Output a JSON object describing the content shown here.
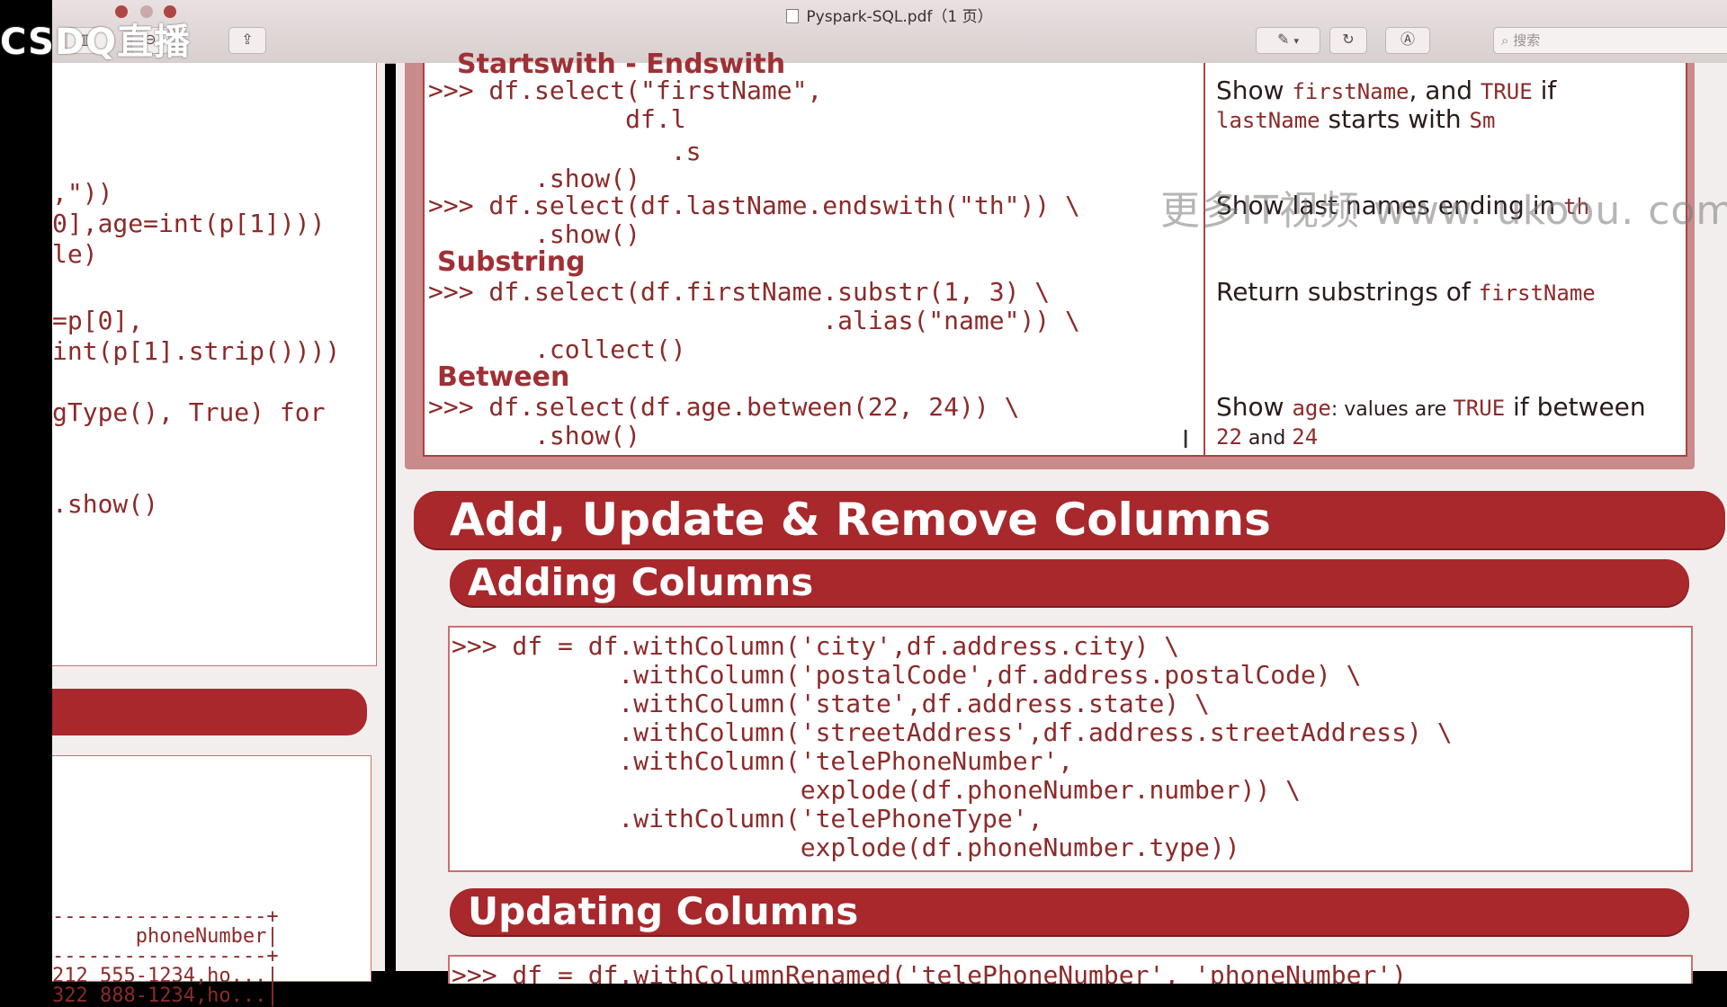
{
  "window": {
    "title": "Pyspark-SQL.pdf（1 页）",
    "overlay_logo": "CSDQ直播",
    "search_placeholder": "搜索",
    "toolbar": {
      "sidebar_icon": "sidebar-icon",
      "zoom_icon": "zoom-icon",
      "share_icon": "share-icon",
      "markup_icon": "pen-icon",
      "rotate_icon": "rotate-icon",
      "annotate_icon": "annotate-icon",
      "search_icon": "search-icon"
    }
  },
  "left_pane": {
    "code_lines": [
      ",\"))",
      "0],age=int(p[1])))",
      "le)",
      "=p[0],",
      "int(p[1].strip())))",
      "gType(), True) for",
      ".show()"
    ],
    "table_lines": [
      "------------------+",
      "       phoneNumber|",
      "------------------+",
      "212 555-1234,ho...|",
      "322 888-1234,ho...|",
      "------------------+"
    ]
  },
  "cheat": {
    "cut_heading": "Startswith - Endswith",
    "rows": [
      {
        "code": ">>> df.select(\"firstName\",",
        "desc": ""
      },
      {
        "code": "             df.l",
        "desc": ""
      },
      {
        "code": "                .s",
        "desc": ""
      },
      {
        "code": "       .show()",
        "desc": ""
      },
      {
        "code": ">>> df.select(df.lastName.endswith(\"th\")) \\",
        "desc": ""
      },
      {
        "code": "       .show()",
        "desc": ""
      },
      {
        "code": ">>> df.select(df.firstName.substr(1, 3) \\",
        "desc": ""
      },
      {
        "code": "                          .alias(\"name\")) \\",
        "desc": ""
      },
      {
        "code": "       .collect()",
        "desc": ""
      },
      {
        "code": ">>> df.select(df.age.between(22, 24)) \\",
        "desc": ""
      },
      {
        "code": "       .show()",
        "desc": ""
      }
    ],
    "headings": {
      "substring": "Substring",
      "between": "Between"
    },
    "desc": {
      "startswith_a": "Show ",
      "startswith_a_mono": "firstName",
      "startswith_b": ", and ",
      "startswith_b_mono": "TRUE",
      "startswith_c": " if",
      "startswith_line2_mono": "lastName",
      "startswith_line2_text": " starts with ",
      "startswith_line2_mono2": "Sm",
      "endswith_text": "Show last names ending in ",
      "endswith_mono": "th",
      "substr_text": "Return substrings of ",
      "substr_mono": "firstName",
      "between_a": "Show ",
      "between_a_mono": "age",
      "between_b": ": values are ",
      "between_b_mono": "TRUE",
      "between_c": " if   between",
      "between_line2_mono": "22",
      "between_line2_text": "  and  ",
      "between_line2_mono2": "24"
    }
  },
  "watermark": "更多IT视频 www. ukoou. com",
  "sections": {
    "main": "Add, Update & Remove Columns",
    "adding": "Adding Columns",
    "updating": "Updating Columns"
  },
  "adding_code": [
    ">>> df = df.withColumn('city',df.address.city) \\",
    "           .withColumn('postalCode',df.address.postalCode) \\",
    "           .withColumn('state',df.address.state) \\",
    "           .withColumn('streetAddress',df.address.streetAddress) \\",
    "           .withColumn('telePhoneNumber',",
    "                       explode(df.phoneNumber.number)) \\",
    "           .withColumn('telePhoneType',",
    "                       explode(df.phoneNumber.type))"
  ],
  "updating_code_partial": ">>> df = df.withColumnRenamed('telePhoneNumber', 'phoneNumber')"
}
